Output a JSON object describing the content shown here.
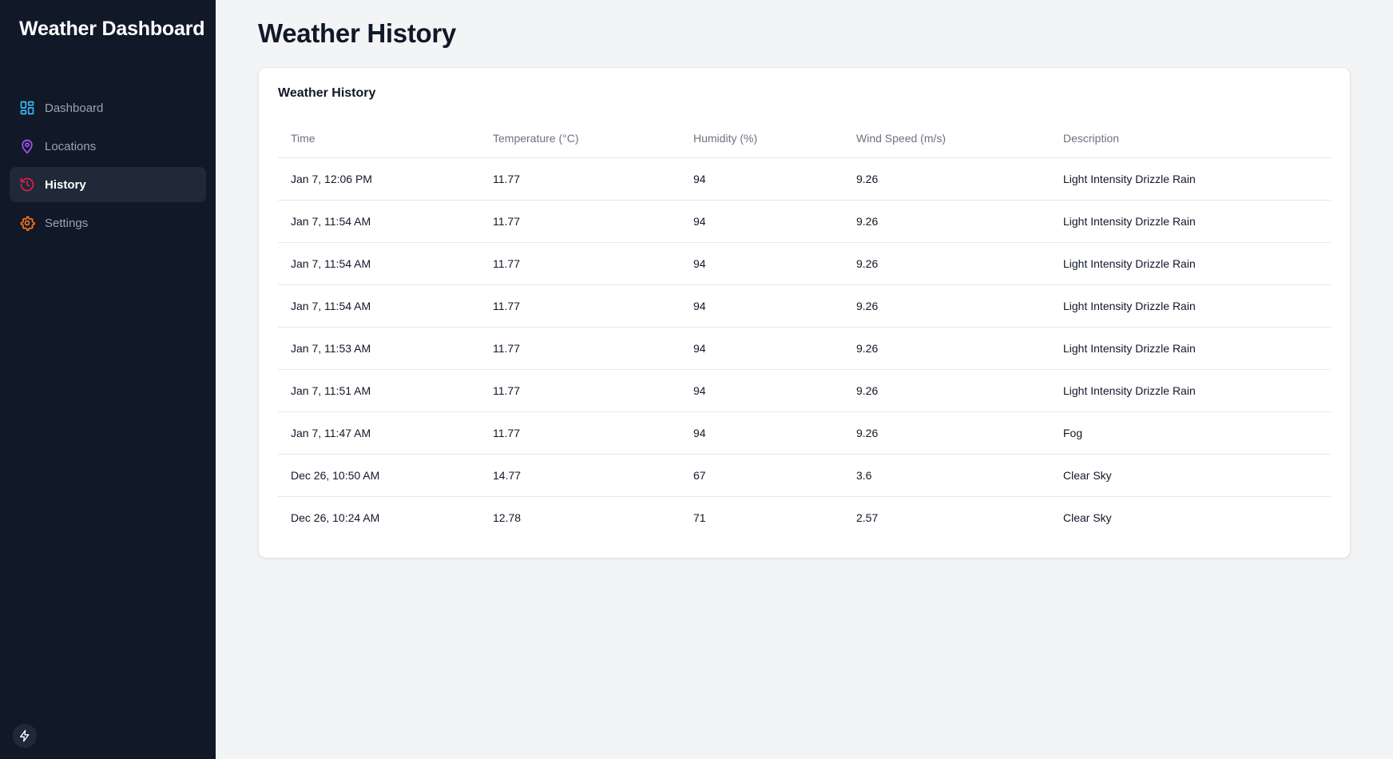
{
  "sidebar": {
    "brand": "Weather Dashboard",
    "items": [
      {
        "label": "Dashboard",
        "icon": "dashboard-icon",
        "color": "#38bdf8",
        "active": false
      },
      {
        "label": "Locations",
        "icon": "map-pin-icon",
        "color": "#a855f7",
        "active": false
      },
      {
        "label": "History",
        "icon": "history-icon",
        "color": "#e11d48",
        "active": true
      },
      {
        "label": "Settings",
        "icon": "gear-icon",
        "color": "#f97316",
        "active": false
      }
    ],
    "footer_icon": "bolt-icon"
  },
  "main": {
    "title": "Weather History",
    "card": {
      "title": "Weather History",
      "columns": [
        "Time",
        "Temperature (°C)",
        "Humidity (%)",
        "Wind Speed (m/s)",
        "Description"
      ],
      "rows": [
        [
          "Jan 7, 12:06 PM",
          "11.77",
          "94",
          "9.26",
          "Light Intensity Drizzle Rain"
        ],
        [
          "Jan 7, 11:54 AM",
          "11.77",
          "94",
          "9.26",
          "Light Intensity Drizzle Rain"
        ],
        [
          "Jan 7, 11:54 AM",
          "11.77",
          "94",
          "9.26",
          "Light Intensity Drizzle Rain"
        ],
        [
          "Jan 7, 11:54 AM",
          "11.77",
          "94",
          "9.26",
          "Light Intensity Drizzle Rain"
        ],
        [
          "Jan 7, 11:53 AM",
          "11.77",
          "94",
          "9.26",
          "Light Intensity Drizzle Rain"
        ],
        [
          "Jan 7, 11:51 AM",
          "11.77",
          "94",
          "9.26",
          "Light Intensity Drizzle Rain"
        ],
        [
          "Jan 7, 11:47 AM",
          "11.77",
          "94",
          "9.26",
          "Fog"
        ],
        [
          "Dec 26, 10:50 AM",
          "14.77",
          "67",
          "3.6",
          "Clear Sky"
        ],
        [
          "Dec 26, 10:24 AM",
          "12.78",
          "71",
          "2.57",
          "Clear Sky"
        ]
      ]
    }
  }
}
